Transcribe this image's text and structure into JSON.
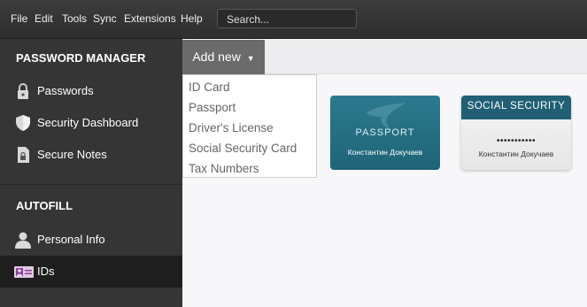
{
  "menubar": {
    "items": [
      "File",
      "Edit",
      "Tools",
      "Sync",
      "Extensions",
      "Help"
    ],
    "search_placeholder": "Search..."
  },
  "sidebar": {
    "password_manager_title": "PASSWORD MANAGER",
    "password_items": [
      {
        "label": "Passwords",
        "icon": "lock-icon"
      },
      {
        "label": "Security Dashboard",
        "icon": "shield-icon"
      },
      {
        "label": "Secure Notes",
        "icon": "note-lock-icon"
      }
    ],
    "autofill_title": "AUTOFILL",
    "autofill_items": [
      {
        "label": "Personal Info",
        "icon": "person-icon"
      },
      {
        "label": "IDs",
        "icon": "id-card-icon",
        "active": true
      }
    ]
  },
  "toolbar": {
    "add_new_label": "Add new"
  },
  "dropdown": {
    "items": [
      "ID Card",
      "Passport",
      "Driver's License",
      "Social Security Card",
      "Tax Numbers"
    ]
  },
  "cards": {
    "passport": {
      "title": "PASSPORT",
      "name": "Константин Докучаев",
      "color": "#2c7a8e"
    },
    "social_security": {
      "title": "SOCIAL SECURITY",
      "number": "•••••••••••",
      "name": "Константин Докучаев",
      "color": "#216074"
    }
  }
}
